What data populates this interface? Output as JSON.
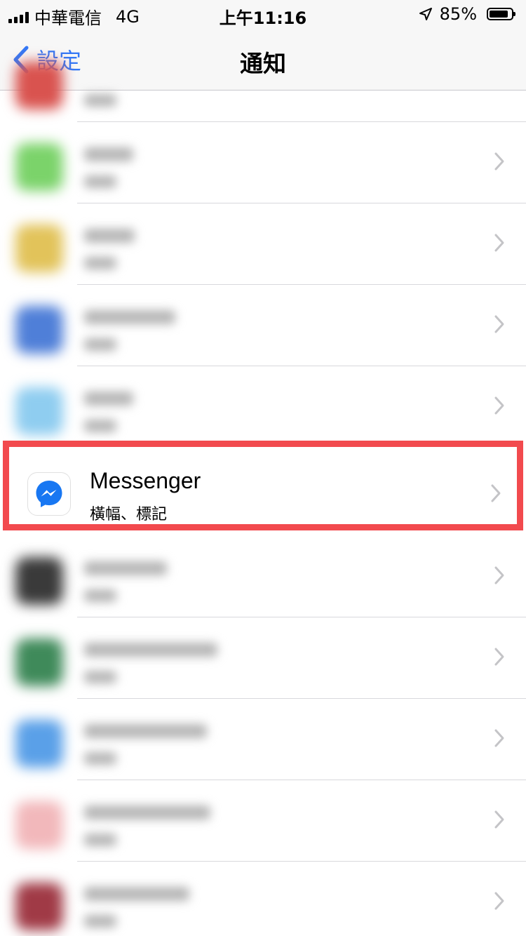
{
  "status_bar": {
    "carrier": "中華電信",
    "network": "4G",
    "time": "上午11:16",
    "battery": "85%",
    "battery_level": 0.85,
    "signal_bars": 4
  },
  "nav": {
    "back_label": "設定",
    "title": "通知"
  },
  "apps": [
    {
      "name": "Messenger",
      "subtitle": "橫幅、標記",
      "highlighted": true
    }
  ],
  "colors": {
    "accent": "#3478f6",
    "highlight_border": "#f24a4e",
    "messenger_blue": "#1877f2"
  }
}
